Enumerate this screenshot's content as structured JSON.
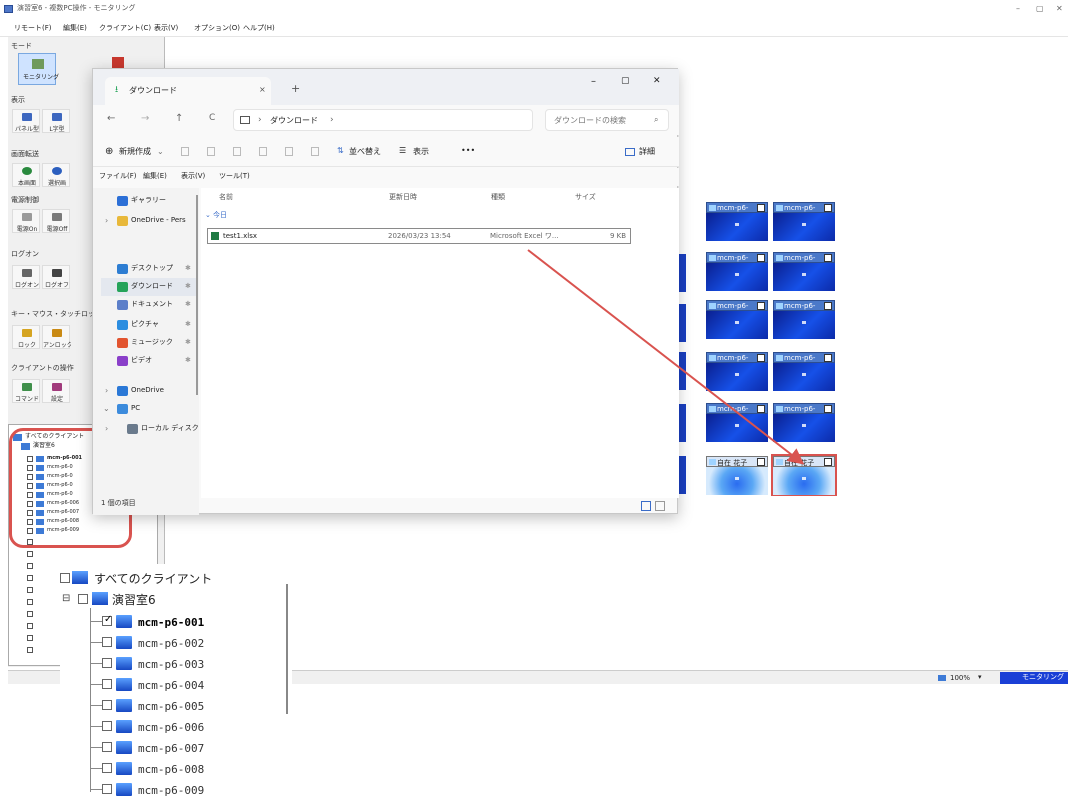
{
  "app": {
    "title": "演習室6 - 複数PC操作 - モニタリング",
    "menu": [
      "リモート(F)",
      "編集(E)",
      "クライアント(C)",
      "表示(V)",
      "オプション(O)",
      "ヘルプ(H)"
    ],
    "window_controls": [
      "–",
      "▢",
      "✕"
    ]
  },
  "left_panel": {
    "sections": [
      {
        "label": "モード",
        "buttons": [
          "モニタリング",
          ""
        ]
      },
      {
        "label": "表示",
        "buttons": [
          "パネル型",
          "L字型"
        ]
      },
      {
        "label": "画面転送",
        "buttons": [
          "本画面",
          "選択画"
        ]
      },
      {
        "label": "電源制御",
        "buttons": [
          "電源On",
          "電源Off"
        ]
      },
      {
        "label": "ログオン",
        "buttons": [
          "ログオン",
          "ログオフ"
        ]
      },
      {
        "label": "キー・マウス・タッチロック",
        "buttons": [
          "ロック",
          "アンロック"
        ]
      },
      {
        "label": "クライアントの操作",
        "buttons": [
          "コマンド",
          "設定"
        ]
      }
    ]
  },
  "small_tree": {
    "root": "すべてのクライアント",
    "group": "演習室6",
    "items": [
      "mcm-p6-001",
      "mcm-p6-0",
      "mcm-p6-0",
      "mcm-p6-0",
      "mcm-p6-0",
      "mcm-p6-006",
      "mcm-p6-007",
      "mcm-p6-008",
      "mcm-p6-009"
    ]
  },
  "statusbar": {
    "zoom": "100%",
    "mode": "モニタリング"
  },
  "explorer": {
    "tab_title": "ダウンロード",
    "new_tab": "+",
    "close_tab": "×",
    "window_controls": [
      "–",
      "▢",
      "✕"
    ],
    "nav_arrows": [
      "←",
      "→",
      "↑",
      "C"
    ],
    "path": [
      "›",
      "ダウンロード",
      "›"
    ],
    "search_placeholder": "ダウンロードの検索",
    "toolbar": {
      "new": "新規作成",
      "sort": "並べ替え",
      "view": "表示",
      "more": "•••",
      "details": "詳細"
    },
    "menu": [
      "ファイル(F)",
      "編集(E)",
      "表示(V)",
      "ツール(T)"
    ],
    "nav": [
      {
        "label": "ギャラリー",
        "color": "#2c6fd6"
      },
      {
        "label": "OneDrive - Pers",
        "color": "#e8b83a"
      },
      {
        "label": "デスクトップ",
        "color": "#2d7dd2"
      },
      {
        "label": "ダウンロード",
        "color": "#25a35a"
      },
      {
        "label": "ドキュメント",
        "color": "#5c7fc9"
      },
      {
        "label": "ピクチャ",
        "color": "#2b8de0"
      },
      {
        "label": "ミュージック",
        "color": "#e2542f"
      },
      {
        "label": "ビデオ",
        "color": "#8a3fc9"
      },
      {
        "label": "OneDrive",
        "color": "#2a78d6"
      },
      {
        "label": "PC",
        "color": "#3c8bdc"
      },
      {
        "label": "ローカル ディスク",
        "color": "#6a7a8c"
      }
    ],
    "columns": [
      "名前",
      "更新日時",
      "種類",
      "サイズ"
    ],
    "group": "今日",
    "files": [
      {
        "name": "test1.xlsx",
        "modified": "2026/03/23 13:54",
        "type": "Microsoft Excel ワ...",
        "size": "9 KB"
      }
    ],
    "status": "1 個の項目"
  },
  "monitors": {
    "label": "mcm-p6-",
    "special_label": "自在 花子",
    "count_columns": 2
  },
  "zoom_tree": {
    "root": "すべてのクライアント",
    "group": "演習室6",
    "items": [
      "mcm-p6-001",
      "mcm-p6-002",
      "mcm-p6-003",
      "mcm-p6-004",
      "mcm-p6-005",
      "mcm-p6-006",
      "mcm-p6-007",
      "mcm-p6-008",
      "mcm-p6-009"
    ],
    "checked_index": 0
  },
  "colors": {
    "annotation": "#d9534f",
    "accent": "#0a3de0",
    "mode_bg": "#1a3fd6"
  }
}
